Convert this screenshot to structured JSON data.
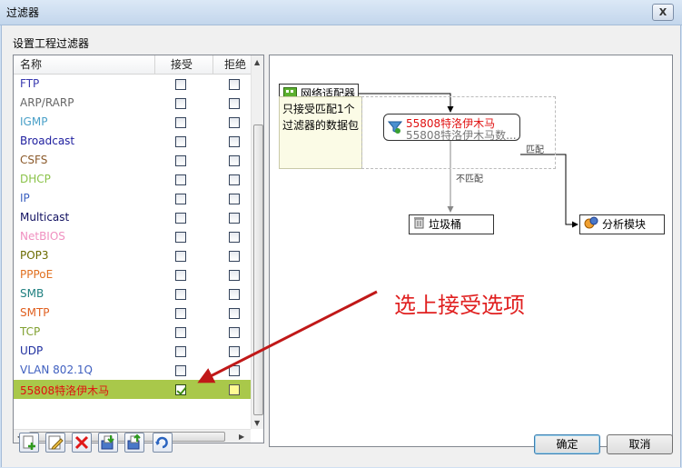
{
  "window": {
    "title": "过滤器",
    "close_label": "X"
  },
  "section_label": "设置工程过滤器",
  "table": {
    "columns": [
      "名称",
      "接受",
      "拒绝"
    ],
    "rows": [
      {
        "name": "FTP",
        "color": "#3a3ab0",
        "accept": false,
        "reject": false
      },
      {
        "name": "ARP/RARP",
        "color": "#666666",
        "accept": false,
        "reject": false
      },
      {
        "name": "IGMP",
        "color": "#4aa0c8",
        "accept": false,
        "reject": false
      },
      {
        "name": "Broadcast",
        "color": "#2020a0",
        "accept": false,
        "reject": false
      },
      {
        "name": "CSFS",
        "color": "#8b5a2b",
        "accept": false,
        "reject": false
      },
      {
        "name": "DHCP",
        "color": "#8bc34a",
        "accept": false,
        "reject": false
      },
      {
        "name": "IP",
        "color": "#3a60c0",
        "accept": false,
        "reject": false
      },
      {
        "name": "Multicast",
        "color": "#101060",
        "accept": false,
        "reject": false
      },
      {
        "name": "NetBIOS",
        "color": "#f090c0",
        "accept": false,
        "reject": false
      },
      {
        "name": "POP3",
        "color": "#6b6b00",
        "accept": false,
        "reject": false
      },
      {
        "name": "PPPoE",
        "color": "#e07020",
        "accept": false,
        "reject": false
      },
      {
        "name": "SMB",
        "color": "#208080",
        "accept": false,
        "reject": false
      },
      {
        "name": "SMTP",
        "color": "#e06020",
        "accept": false,
        "reject": false
      },
      {
        "name": "TCP",
        "color": "#80a030",
        "accept": false,
        "reject": false
      },
      {
        "name": "UDP",
        "color": "#2030a0",
        "accept": false,
        "reject": false
      },
      {
        "name": "VLAN 802.1Q",
        "color": "#4060c0",
        "accept": false,
        "reject": false
      },
      {
        "name": "55808特洛伊木马",
        "color": "#e01010",
        "accept": true,
        "reject": false,
        "selected": true
      }
    ]
  },
  "diagram": {
    "adapter_label": "网络适配器",
    "note": "只接受匹配1个过滤器的数据包",
    "filter_name": "55808特洛伊木马",
    "filter_sub": "55808特洛伊木马数...",
    "match_label": "匹配",
    "nomatch_label": "不匹配",
    "trash_label": "垃圾桶",
    "analysis_label": "分析模块",
    "annotation": "选上接受选项"
  },
  "toolbar": {
    "icons": [
      "add-icon",
      "edit-icon",
      "delete-icon",
      "import-icon",
      "export-icon",
      "refresh-icon"
    ]
  },
  "buttons": {
    "ok": "确定",
    "cancel": "取消"
  }
}
